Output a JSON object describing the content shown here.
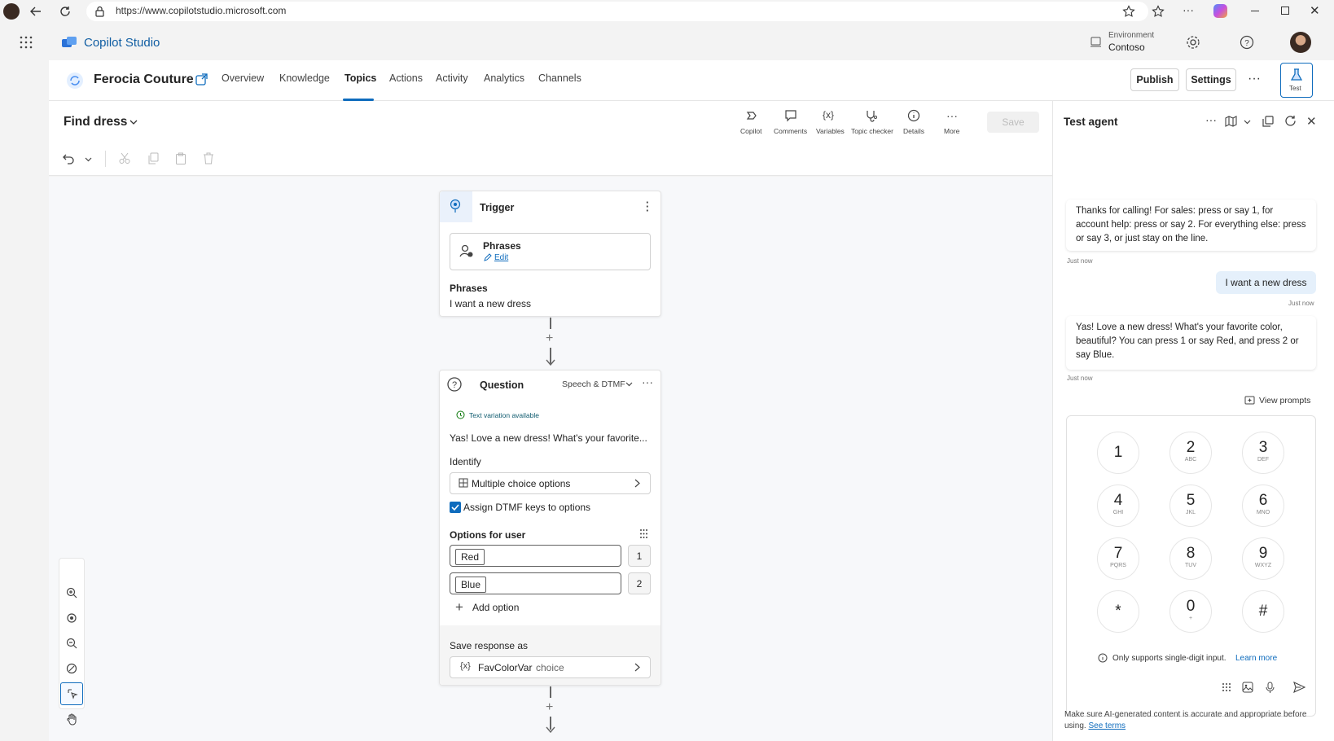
{
  "browser": {
    "url": "https://www.copilotstudio.microsoft.com"
  },
  "app": {
    "name": "Copilot Studio",
    "environment_label": "Environment",
    "environment_value": "Contoso"
  },
  "agent": {
    "name": "Ferocia Couture",
    "tabs": [
      "Overview",
      "Knowledge",
      "Topics",
      "Actions",
      "Activity",
      "Analytics",
      "Channels"
    ],
    "active_tab": "Topics",
    "publish_label": "Publish",
    "settings_label": "Settings",
    "test_label": "Test"
  },
  "topic": {
    "title": "Find dress",
    "tools": [
      "Copilot",
      "Comments",
      "Variables",
      "Topic checker",
      "Details",
      "More"
    ],
    "save_label": "Save"
  },
  "trigger": {
    "title": "Trigger",
    "card_title": "Phrases",
    "edit_label": "Edit",
    "phrases_label": "Phrases",
    "phrase": "I want a new dress"
  },
  "question": {
    "title": "Question",
    "mode": "Speech & DTMF",
    "variation_note": "Text variation available",
    "message": "Yas! Love a new dress! What's your favorite...",
    "identify_label": "Identify",
    "identify_value": "Multiple choice options",
    "dtmf_label": "Assign DTMF keys to options",
    "dtmf_checked": true,
    "options_label": "Options for user",
    "options": [
      {
        "label": "Red",
        "key": "1"
      },
      {
        "label": "Blue",
        "key": "2"
      }
    ],
    "add_option_label": "Add option",
    "save_label": "Save response as",
    "var_name": "FavColorVar",
    "var_type": "choice"
  },
  "test_panel": {
    "title": "Test agent",
    "messages": [
      {
        "from": "bot",
        "text": "Thanks for calling! For sales: press or say 1, for account help: press or say 2. For everything else: press or say 3, or just stay on the line.",
        "time": "Just now"
      },
      {
        "from": "user",
        "text": "I want a new dress",
        "time": "Just now"
      },
      {
        "from": "bot",
        "text": "Yas! Love a new dress! What's your favorite color, beautiful? You can press 1 or say Red, and press 2 or say Blue.",
        "time": "Just now"
      }
    ],
    "view_prompts_label": "View prompts",
    "keypad": [
      {
        "num": "1",
        "sub": ""
      },
      {
        "num": "2",
        "sub": "ABC"
      },
      {
        "num": "3",
        "sub": "DEF"
      },
      {
        "num": "4",
        "sub": "GHI"
      },
      {
        "num": "5",
        "sub": "JKL"
      },
      {
        "num": "6",
        "sub": "MNO"
      },
      {
        "num": "7",
        "sub": "PQRS"
      },
      {
        "num": "8",
        "sub": "TUV"
      },
      {
        "num": "9",
        "sub": "WXYZ"
      },
      {
        "num": "*",
        "sub": ""
      },
      {
        "num": "0",
        "sub": "+"
      },
      {
        "num": "#",
        "sub": ""
      }
    ],
    "hint": "Only supports single-digit input.",
    "hint_link": "Learn more",
    "disclaimer": "Make sure AI-generated content is accurate and appropriate before using.",
    "disclaimer_link": "See terms"
  },
  "colors": {
    "accent": "#0f6cbd",
    "brand": "#115ea3"
  }
}
